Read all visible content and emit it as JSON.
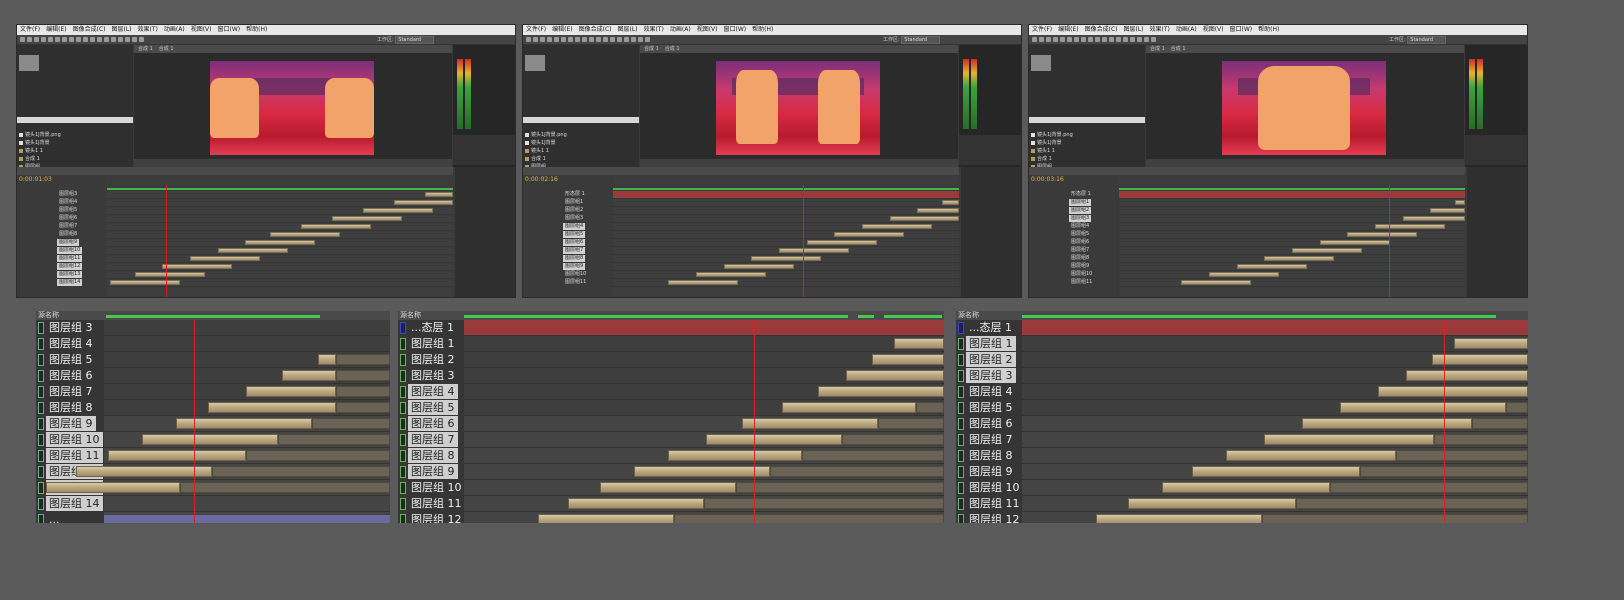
{
  "top_shots": [
    {
      "menu": [
        "文件(F)",
        "编辑(E)",
        "图像合成(C)",
        "图层(L)",
        "效果(T)",
        "动画(A)",
        "视图(V)",
        "窗口(W)",
        "帮助(H)"
      ],
      "workspace_label": "工作区:",
      "workspace_value": "Standard",
      "timecode": "0:00:01:03",
      "comp_tabs": [
        "合成 1",
        "合成 1"
      ],
      "project_items": [
        "镜头1J背景.png",
        "镜头1J背景",
        "镜头1 1",
        "合成 1",
        "图层组"
      ],
      "layers": [
        "图层组3",
        "图层组4",
        "图层组5",
        "图层组6",
        "图层组7",
        "图层组8",
        "图层组9",
        "图层组10",
        "图层组11",
        "图层组12",
        "图层组13",
        "图层组14"
      ]
    },
    {
      "menu": [
        "文件(F)",
        "编辑(E)",
        "图像合成(C)",
        "图层(L)",
        "效果(T)",
        "动画(A)",
        "视图(V)",
        "窗口(W)",
        "帮助(H)"
      ],
      "workspace_label": "工作区:",
      "workspace_value": "Standard",
      "timecode": "0:00:02:16",
      "comp_tabs": [
        "合成 1",
        "合成 1"
      ],
      "project_items": [
        "镜头1J背景.png",
        "镜头1J背景",
        "镜头1 1",
        "合成 1",
        "图层组"
      ],
      "layers": [
        "形态层 1",
        "图层组1",
        "图层组2",
        "图层组3",
        "图层组4",
        "图层组5",
        "图层组6",
        "图层组7",
        "图层组8",
        "图层组9",
        "图层组10",
        "图层组11"
      ]
    },
    {
      "menu": [
        "文件(F)",
        "编辑(E)",
        "图像合成(C)",
        "图层(L)",
        "效果(T)",
        "动画(A)",
        "视图(V)",
        "窗口(W)",
        "帮助(H)"
      ],
      "workspace_label": "工作区:",
      "workspace_value": "Standard",
      "timecode": "0:00:03:16",
      "comp_tabs": [
        "合成 1",
        "合成 1"
      ],
      "project_items": [
        "镜头1J背景.png",
        "镜头1J背景",
        "镜头1 1",
        "合成 1",
        "图层组"
      ],
      "layers": [
        "形态层 1",
        "图层组1",
        "图层组2",
        "图层组3",
        "图层组4",
        "图层组5",
        "图层组6",
        "图层组7",
        "图层组8",
        "图层组9",
        "图层组10",
        "图层组11"
      ]
    }
  ],
  "zoom_panels": [
    {
      "header": "源名称",
      "rows": [
        {
          "label": "图层组 3",
          "selected": false
        },
        {
          "label": "图层组 4",
          "selected": false
        },
        {
          "label": "图层组 5",
          "selected": false
        },
        {
          "label": "图层组 6",
          "selected": false
        },
        {
          "label": "图层组 7",
          "selected": false
        },
        {
          "label": "图层组 8",
          "selected": false
        },
        {
          "label": "图层组 9",
          "selected": true
        },
        {
          "label": "图层组 10",
          "selected": true
        },
        {
          "label": "图层组 11",
          "selected": true
        },
        {
          "label": "图层组 12",
          "selected": true
        },
        {
          "label": "图层组 13",
          "selected": true
        },
        {
          "label": "图层组 14",
          "selected": true
        },
        {
          "label": "...",
          "selected": false
        }
      ]
    },
    {
      "header": "源名称",
      "rows": [
        {
          "label": "...态层 1",
          "selected": false
        },
        {
          "label": "图层组 1",
          "selected": false
        },
        {
          "label": "图层组 2",
          "selected": false
        },
        {
          "label": "图层组 3",
          "selected": false
        },
        {
          "label": "图层组 4",
          "selected": true
        },
        {
          "label": "图层组 5",
          "selected": true
        },
        {
          "label": "图层组 6",
          "selected": true
        },
        {
          "label": "图层组 7",
          "selected": true
        },
        {
          "label": "图层组 8",
          "selected": true
        },
        {
          "label": "图层组 9",
          "selected": true
        },
        {
          "label": "图层组 10",
          "selected": false
        },
        {
          "label": "图层组 11",
          "selected": false
        },
        {
          "label": "图层组 12",
          "selected": false
        }
      ]
    },
    {
      "header": "源名称",
      "rows": [
        {
          "label": "...态层 1",
          "selected": false
        },
        {
          "label": "图层组 1",
          "selected": true
        },
        {
          "label": "图层组 2",
          "selected": true
        },
        {
          "label": "图层组 3",
          "selected": true
        },
        {
          "label": "图层组 4",
          "selected": false
        },
        {
          "label": "图层组 5",
          "selected": false
        },
        {
          "label": "图层组 6",
          "selected": false
        },
        {
          "label": "图层组 7",
          "selected": false
        },
        {
          "label": "图层组 8",
          "selected": false
        },
        {
          "label": "图层组 9",
          "selected": false
        },
        {
          "label": "图层组 10",
          "selected": false
        },
        {
          "label": "图层组 11",
          "selected": false
        },
        {
          "label": "图层组 12",
          "selected": false
        }
      ]
    }
  ],
  "colors": {
    "background": "#5a5a5a",
    "clip": "#b8a781",
    "playhead": "#d42323",
    "work_area": "#46c94f",
    "solid_layer": "#9a3a3a"
  }
}
